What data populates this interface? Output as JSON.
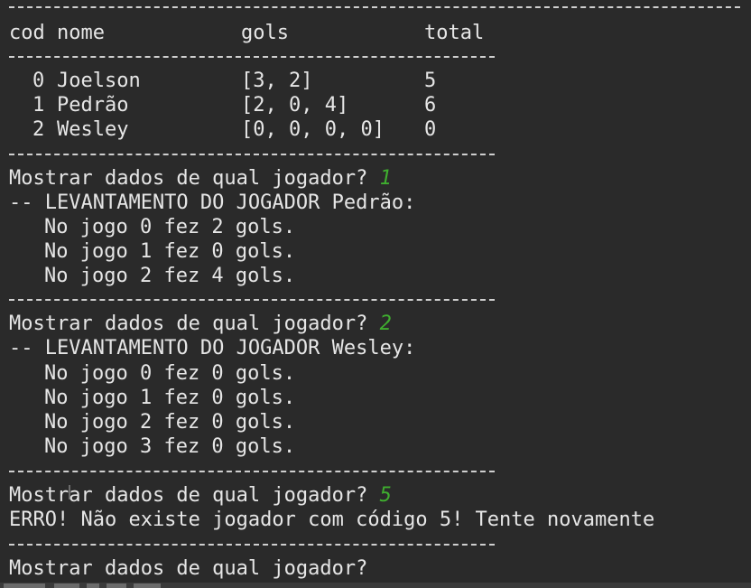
{
  "table": {
    "headers": {
      "cod": "cod",
      "nome": "nome",
      "gols": "gols",
      "total": "total"
    },
    "rows": [
      {
        "cod": "0",
        "nome": "Joelson",
        "gols": "[3, 2]",
        "total": "5"
      },
      {
        "cod": "1",
        "nome": "Pedrão",
        "gols": "[2, 0, 4]",
        "total": "6"
      },
      {
        "cod": "2",
        "nome": "Wesley",
        "gols": "[0, 0, 0, 0]",
        "total": "0"
      }
    ]
  },
  "queries": [
    {
      "prompt": "Mostrar dados de qual jogador?",
      "answer": "1",
      "header": "-- LEVANTAMENTO DO JOGADOR Pedrão:",
      "lines": [
        "No jogo 0 fez 2 gols.",
        "No jogo 1 fez 0 gols.",
        "No jogo 2 fez 4 gols."
      ]
    },
    {
      "prompt": "Mostrar dados de qual jogador?",
      "answer": "2",
      "header": "-- LEVANTAMENTO DO JOGADOR Wesley:",
      "lines": [
        "No jogo 0 fez 0 gols.",
        "No jogo 1 fez 0 gols.",
        "No jogo 2 fez 0 gols.",
        "No jogo 3 fez 0 gols."
      ]
    },
    {
      "prompt": "Mostrar dados de qual jogador?",
      "answer": "5",
      "error": "ERRO! Não existe jogador com código 5! Tente novamente"
    },
    {
      "prompt": "Mostrar dados de qual jogador?"
    }
  ],
  "colors": {
    "background": "#2a2a2a",
    "text": "#e6e6e6",
    "input_answer": "#3fae2f"
  }
}
